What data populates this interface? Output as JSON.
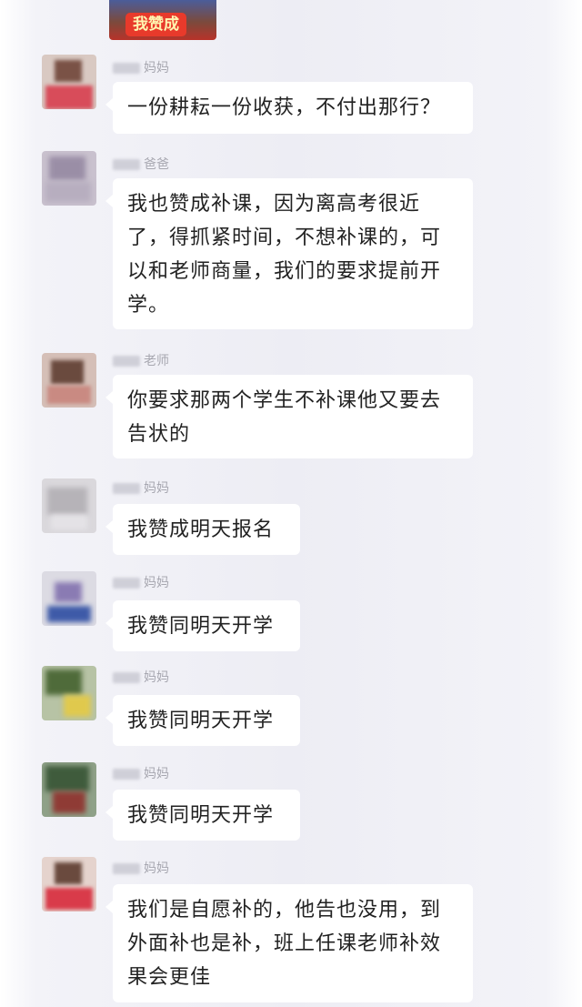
{
  "top_sticker": {
    "text": "我赞成"
  },
  "messages": [
    {
      "sender": "妈妈",
      "text": "一份耕耘一份收获，不付出那行？"
    },
    {
      "sender": "爸爸",
      "text": "我也赞成补课，因为离高考很近了，得抓紧时间，不想补课的，可以和老师商量，我们的要求提前开学。"
    },
    {
      "sender": "老师",
      "text": "你要求那两个学生不补课他又要去告状的"
    },
    {
      "sender": "妈妈",
      "text": "我赞成明天报名"
    },
    {
      "sender": "妈妈",
      "text": "我赞同明天开学"
    },
    {
      "sender": "妈妈",
      "text": "我赞同明天开学"
    },
    {
      "sender": "妈妈",
      "text": "我赞同明天开学"
    },
    {
      "sender": "妈妈",
      "text": "我们是自愿补的，他告也没用，到外面补也是补，班上任课老师补效果会更佳"
    }
  ]
}
